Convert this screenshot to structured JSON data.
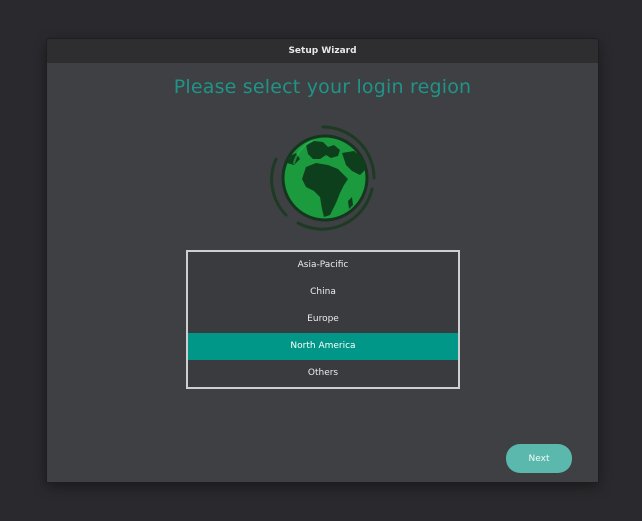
{
  "window": {
    "title": "Setup Wizard"
  },
  "main": {
    "heading": "Please select your login region",
    "illustration_icon": "globe-icon",
    "regions": [
      {
        "label": "Asia-Pacific",
        "selected": false
      },
      {
        "label": "China",
        "selected": false
      },
      {
        "label": "Europe",
        "selected": false
      },
      {
        "label": "North America",
        "selected": true
      },
      {
        "label": "Others",
        "selected": false
      }
    ]
  },
  "footer": {
    "next_label": "Next"
  },
  "colors": {
    "accent": "#009688",
    "heading": "#1f9488",
    "button": "#5bb8ac",
    "globe_land": "#0d7a34",
    "globe_sea": "#1c9a3e"
  }
}
